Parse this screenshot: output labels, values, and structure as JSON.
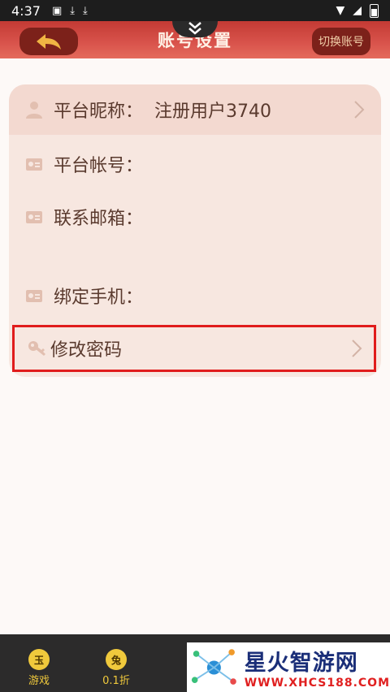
{
  "status_bar": {
    "time": "4:37"
  },
  "header": {
    "title": "账号设置",
    "switch_account_label": "切换账号"
  },
  "rows": {
    "nickname": {
      "label": "平台昵称：",
      "value": "注册用户3740"
    },
    "account": {
      "label": "平台帐号："
    },
    "email": {
      "label": "联系邮箱："
    },
    "phone": {
      "label": "绑定手机："
    },
    "change_password": {
      "label": "修改密码"
    }
  },
  "bottom_nav": {
    "items": [
      {
        "badge": "玉",
        "label": "游戏"
      },
      {
        "badge": "兔",
        "label": "0.1折"
      }
    ]
  },
  "watermark": {
    "title": "星火智游网",
    "url": "WWW.XHCS188.COM"
  },
  "colors": {
    "header": "#d9544c",
    "card": "#f7e7e0",
    "highlight_border": "#e01c1c",
    "nav_accent": "#f0c93c"
  }
}
